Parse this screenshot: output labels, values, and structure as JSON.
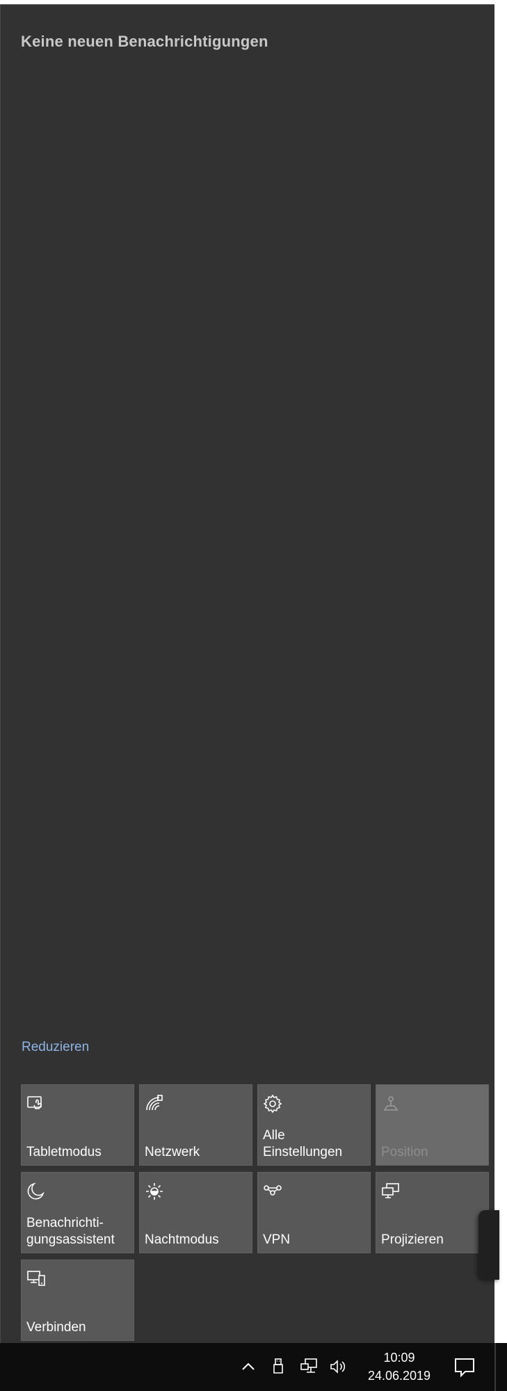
{
  "action_center": {
    "header_title": "Keine neuen Benachrichtigungen",
    "collapse_label": "Reduzieren",
    "tiles": [
      {
        "label": "Tabletmodus",
        "icon": "tablet-mode-icon",
        "enabled": true
      },
      {
        "label": "Netzwerk",
        "icon": "network-icon",
        "enabled": true
      },
      {
        "label": "Alle\nEinstellungen",
        "icon": "gear-icon",
        "enabled": true
      },
      {
        "label": "Position",
        "icon": "location-icon",
        "enabled": false
      },
      {
        "label": "Benachrichti-\ngungsassistent",
        "icon": "moon-icon",
        "enabled": true
      },
      {
        "label": "Nachtmodus",
        "icon": "brightness-icon",
        "enabled": true
      },
      {
        "label": "VPN",
        "icon": "vpn-icon",
        "enabled": true
      },
      {
        "label": "Projizieren",
        "icon": "project-icon",
        "enabled": true
      },
      {
        "label": "Verbinden",
        "icon": "connect-icon",
        "enabled": true
      }
    ]
  },
  "taskbar": {
    "tray_icons": [
      "chevron-up-icon",
      "usb-icon",
      "network-wired-icon",
      "volume-icon"
    ],
    "time": "10:09",
    "date": "24.06.2019",
    "notification_icon": "notification-icon"
  },
  "colors": {
    "panel_bg": "#323232",
    "tile_bg": "#585858",
    "tile_disabled_bg": "#6b6b6b",
    "link": "#8fb4e6",
    "taskbar_bg": "#0d0d0d"
  }
}
